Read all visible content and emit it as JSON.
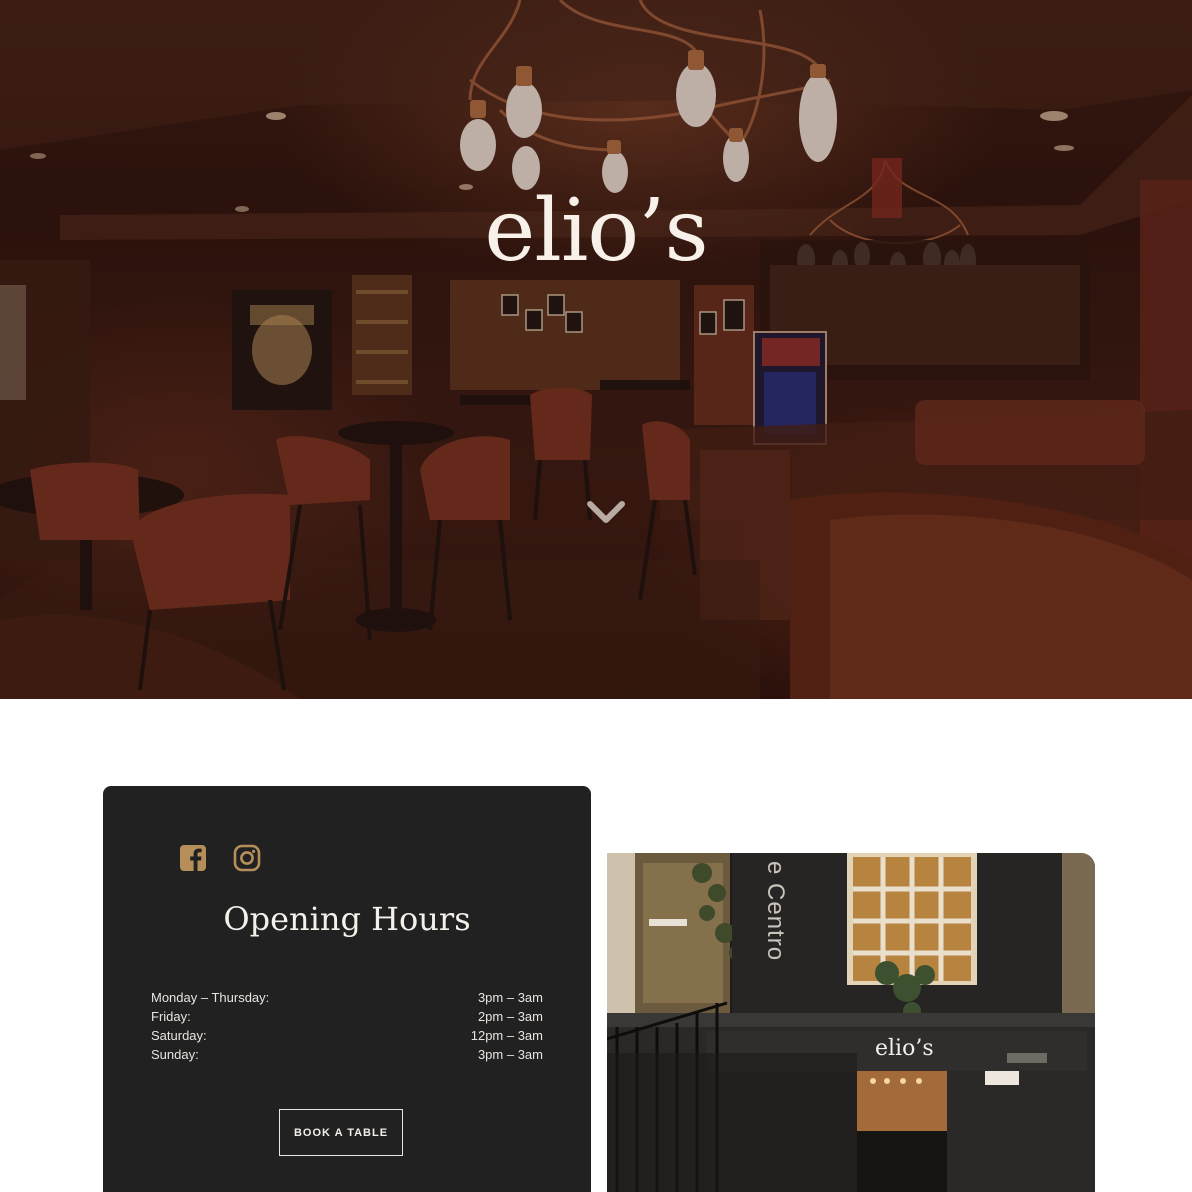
{
  "hero": {
    "logo_text": "elio’s"
  },
  "hours": {
    "title": "Opening Hours",
    "rows": [
      {
        "day": "Monday – Thursday:",
        "time": "3pm – 3am"
      },
      {
        "day": "Friday:",
        "time": "2pm – 3am"
      },
      {
        "day": "Saturday:",
        "time": "12pm – 3am"
      },
      {
        "day": "Sunday:",
        "time": "3pm – 3am"
      }
    ],
    "book_label": "BOOK A TABLE"
  },
  "storefront": {
    "sign_text": "elio’s",
    "vertical_text": "e Centro"
  },
  "colors": {
    "accent_gold": "#b68e5a",
    "card_bg": "#222121",
    "text_light": "#f4f0ea"
  },
  "icons": {
    "scroll": "chevron-down-icon",
    "facebook": "facebook-icon",
    "instagram": "instagram-icon"
  }
}
